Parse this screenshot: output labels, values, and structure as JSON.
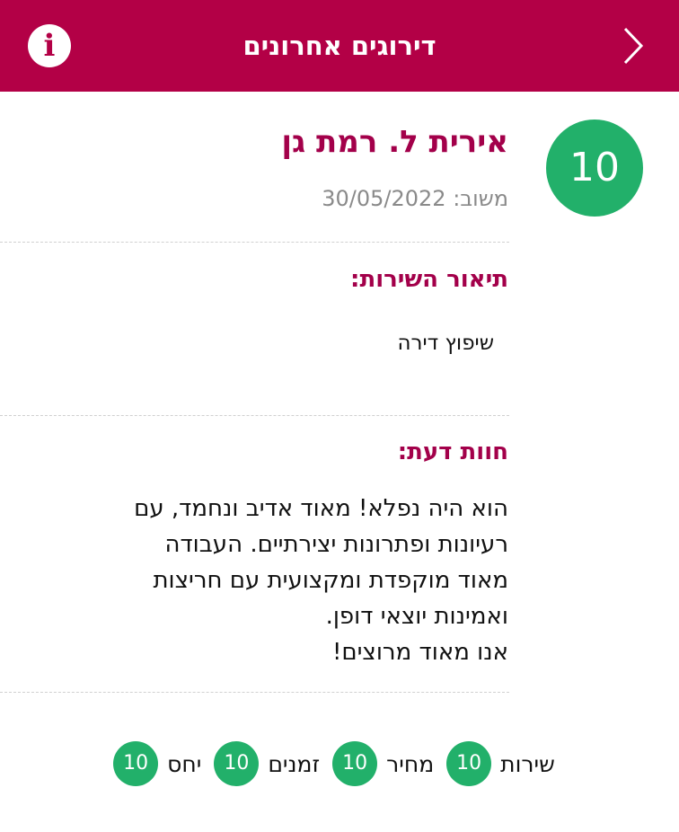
{
  "header": {
    "title": "דירוגים אחרונים",
    "back_icon": "chevron-right-icon",
    "info_icon": "info-icon",
    "info_glyph": "i"
  },
  "review": {
    "score": "10",
    "reviewer": "אירית ל. רמת גן",
    "date": "משוב: 30/05/2022",
    "service_title": "תיאור השירות:",
    "service_text": "שיפוץ דירה",
    "opinion_title": "חוות דעת:",
    "opinion_text": "הוא היה נפלא! מאוד אדיב ונחמד, עם\nרעיונות ופתרונות יצירתיים. העבודה\nמאוד מוקפדת ומקצועית עם חריצות\nואמינות יוצאי דופן.\nאנו מאוד מרוצים!"
  },
  "ratings": [
    {
      "label": "שירות",
      "value": "10"
    },
    {
      "label": "מחיר",
      "value": "10"
    },
    {
      "label": "זמנים",
      "value": "10"
    },
    {
      "label": "יחס",
      "value": "10"
    }
  ],
  "colors": {
    "brand": "#b30046",
    "accent_text": "#a3004a",
    "score_green": "#22b06a"
  }
}
